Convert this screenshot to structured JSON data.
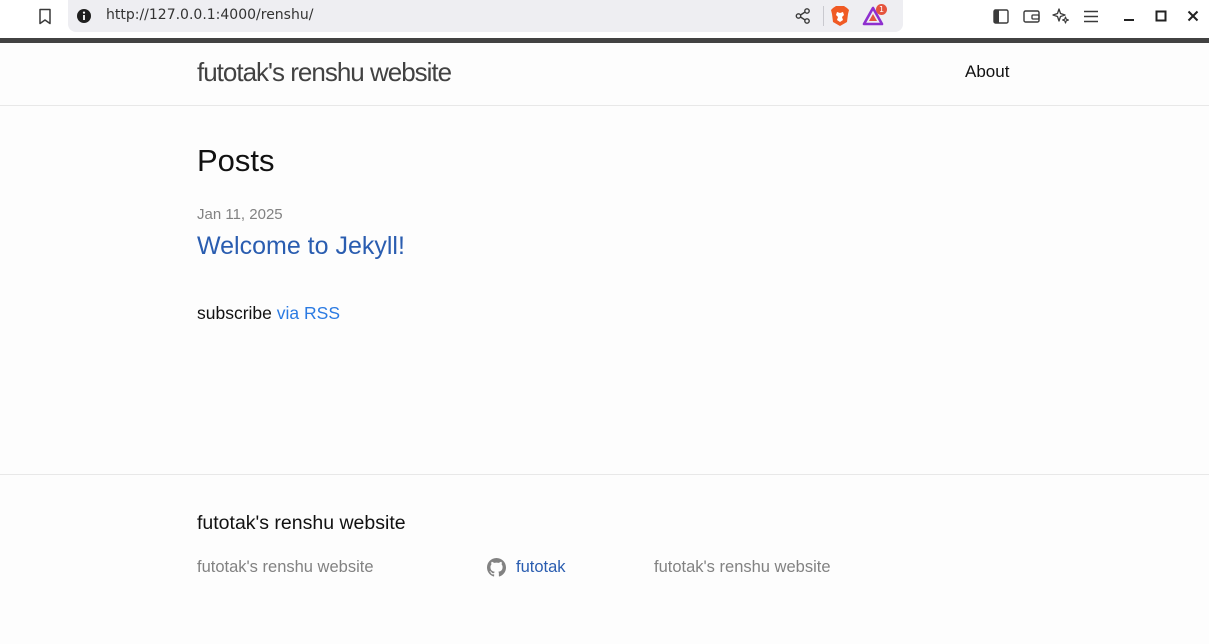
{
  "browser": {
    "url": "http://127.0.0.1:4000/renshu/",
    "rewards_badge": "1",
    "icons": [
      "bookmark-icon",
      "site-info-icon",
      "share-icon",
      "brave-shields-icon",
      "brave-rewards-icon",
      "sidebar-icon",
      "wallet-icon",
      "leo-ai-icon",
      "menu-icon",
      "minimize-icon",
      "maximize-icon",
      "close-icon"
    ]
  },
  "header": {
    "site_title": "futotak's renshu website",
    "nav": [
      {
        "label": "About"
      }
    ]
  },
  "main": {
    "heading": "Posts",
    "posts": [
      {
        "date": "Jan 11, 2025",
        "title": "Welcome to Jekyll!"
      }
    ],
    "rss": {
      "prefix": "subscribe",
      "link_text": "via RSS"
    }
  },
  "footer": {
    "heading": "futotak's renshu website",
    "col1": "futotak's renshu website",
    "github_username": "futotak",
    "col3": "futotak's renshu website"
  },
  "colors": {
    "accent_bar": "#424242",
    "link": "#2a5db0",
    "rss_link": "#2a7ae2",
    "meta": "#828282",
    "background": "#fdfdfd"
  }
}
